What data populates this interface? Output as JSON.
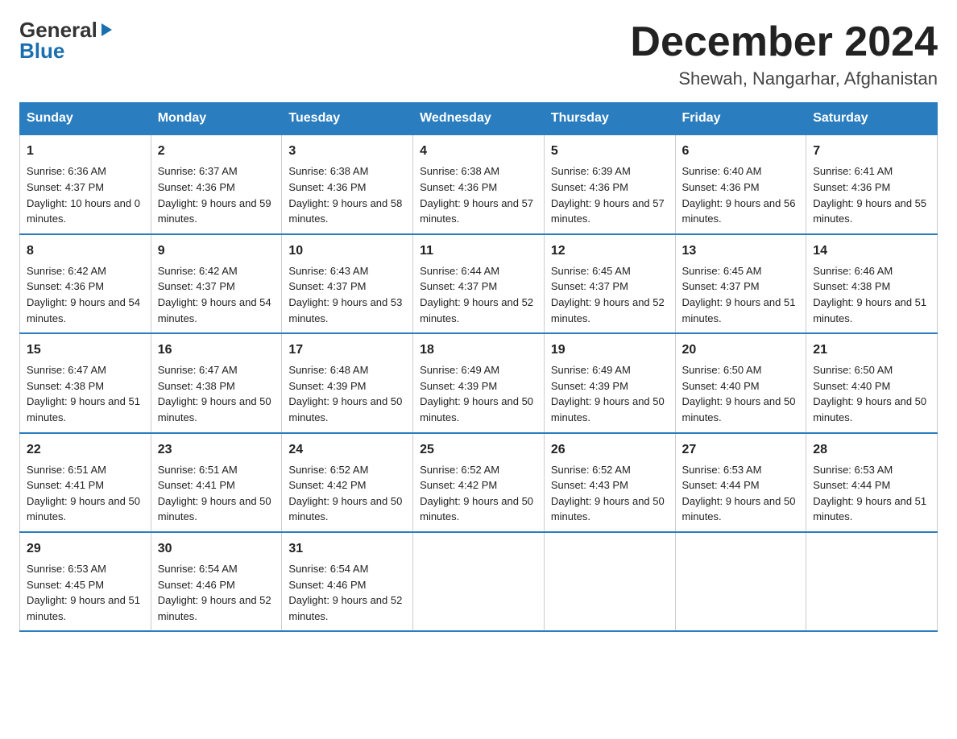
{
  "header": {
    "logo_general": "General",
    "logo_blue": "Blue",
    "month_title": "December 2024",
    "location": "Shewah, Nangarhar, Afghanistan"
  },
  "days_of_week": [
    "Sunday",
    "Monday",
    "Tuesday",
    "Wednesday",
    "Thursday",
    "Friday",
    "Saturday"
  ],
  "weeks": [
    [
      {
        "day": "1",
        "sunrise": "6:36 AM",
        "sunset": "4:37 PM",
        "daylight": "10 hours and 0 minutes."
      },
      {
        "day": "2",
        "sunrise": "6:37 AM",
        "sunset": "4:36 PM",
        "daylight": "9 hours and 59 minutes."
      },
      {
        "day": "3",
        "sunrise": "6:38 AM",
        "sunset": "4:36 PM",
        "daylight": "9 hours and 58 minutes."
      },
      {
        "day": "4",
        "sunrise": "6:38 AM",
        "sunset": "4:36 PM",
        "daylight": "9 hours and 57 minutes."
      },
      {
        "day": "5",
        "sunrise": "6:39 AM",
        "sunset": "4:36 PM",
        "daylight": "9 hours and 57 minutes."
      },
      {
        "day": "6",
        "sunrise": "6:40 AM",
        "sunset": "4:36 PM",
        "daylight": "9 hours and 56 minutes."
      },
      {
        "day": "7",
        "sunrise": "6:41 AM",
        "sunset": "4:36 PM",
        "daylight": "9 hours and 55 minutes."
      }
    ],
    [
      {
        "day": "8",
        "sunrise": "6:42 AM",
        "sunset": "4:36 PM",
        "daylight": "9 hours and 54 minutes."
      },
      {
        "day": "9",
        "sunrise": "6:42 AM",
        "sunset": "4:37 PM",
        "daylight": "9 hours and 54 minutes."
      },
      {
        "day": "10",
        "sunrise": "6:43 AM",
        "sunset": "4:37 PM",
        "daylight": "9 hours and 53 minutes."
      },
      {
        "day": "11",
        "sunrise": "6:44 AM",
        "sunset": "4:37 PM",
        "daylight": "9 hours and 52 minutes."
      },
      {
        "day": "12",
        "sunrise": "6:45 AM",
        "sunset": "4:37 PM",
        "daylight": "9 hours and 52 minutes."
      },
      {
        "day": "13",
        "sunrise": "6:45 AM",
        "sunset": "4:37 PM",
        "daylight": "9 hours and 51 minutes."
      },
      {
        "day": "14",
        "sunrise": "6:46 AM",
        "sunset": "4:38 PM",
        "daylight": "9 hours and 51 minutes."
      }
    ],
    [
      {
        "day": "15",
        "sunrise": "6:47 AM",
        "sunset": "4:38 PM",
        "daylight": "9 hours and 51 minutes."
      },
      {
        "day": "16",
        "sunrise": "6:47 AM",
        "sunset": "4:38 PM",
        "daylight": "9 hours and 50 minutes."
      },
      {
        "day": "17",
        "sunrise": "6:48 AM",
        "sunset": "4:39 PM",
        "daylight": "9 hours and 50 minutes."
      },
      {
        "day": "18",
        "sunrise": "6:49 AM",
        "sunset": "4:39 PM",
        "daylight": "9 hours and 50 minutes."
      },
      {
        "day": "19",
        "sunrise": "6:49 AM",
        "sunset": "4:39 PM",
        "daylight": "9 hours and 50 minutes."
      },
      {
        "day": "20",
        "sunrise": "6:50 AM",
        "sunset": "4:40 PM",
        "daylight": "9 hours and 50 minutes."
      },
      {
        "day": "21",
        "sunrise": "6:50 AM",
        "sunset": "4:40 PM",
        "daylight": "9 hours and 50 minutes."
      }
    ],
    [
      {
        "day": "22",
        "sunrise": "6:51 AM",
        "sunset": "4:41 PM",
        "daylight": "9 hours and 50 minutes."
      },
      {
        "day": "23",
        "sunrise": "6:51 AM",
        "sunset": "4:41 PM",
        "daylight": "9 hours and 50 minutes."
      },
      {
        "day": "24",
        "sunrise": "6:52 AM",
        "sunset": "4:42 PM",
        "daylight": "9 hours and 50 minutes."
      },
      {
        "day": "25",
        "sunrise": "6:52 AM",
        "sunset": "4:42 PM",
        "daylight": "9 hours and 50 minutes."
      },
      {
        "day": "26",
        "sunrise": "6:52 AM",
        "sunset": "4:43 PM",
        "daylight": "9 hours and 50 minutes."
      },
      {
        "day": "27",
        "sunrise": "6:53 AM",
        "sunset": "4:44 PM",
        "daylight": "9 hours and 50 minutes."
      },
      {
        "day": "28",
        "sunrise": "6:53 AM",
        "sunset": "4:44 PM",
        "daylight": "9 hours and 51 minutes."
      }
    ],
    [
      {
        "day": "29",
        "sunrise": "6:53 AM",
        "sunset": "4:45 PM",
        "daylight": "9 hours and 51 minutes."
      },
      {
        "day": "30",
        "sunrise": "6:54 AM",
        "sunset": "4:46 PM",
        "daylight": "9 hours and 52 minutes."
      },
      {
        "day": "31",
        "sunrise": "6:54 AM",
        "sunset": "4:46 PM",
        "daylight": "9 hours and 52 minutes."
      },
      null,
      null,
      null,
      null
    ]
  ]
}
